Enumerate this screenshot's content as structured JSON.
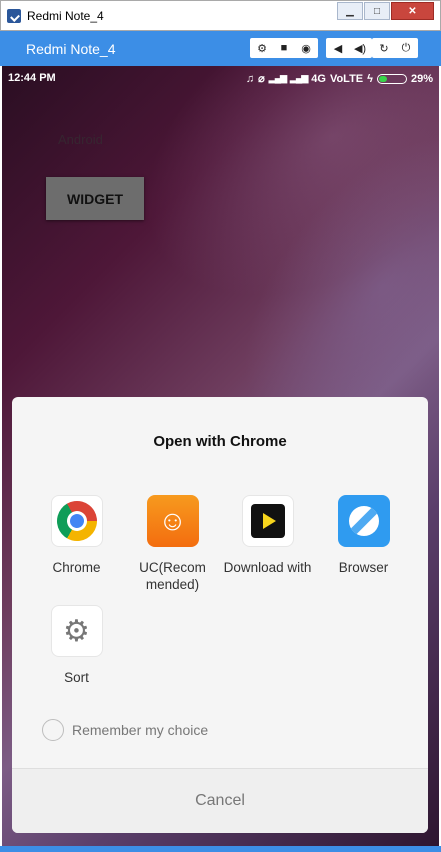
{
  "window": {
    "title": "Redmi Note_4",
    "controls": {
      "minimize": "▁",
      "maximize": "□",
      "close": "✕"
    }
  },
  "emulator": {
    "device_name": "Redmi Note_4",
    "tools": [
      {
        "name": "settings-icon",
        "glyph": "⚙"
      },
      {
        "name": "video-record-icon",
        "glyph": "■"
      },
      {
        "name": "camera-icon",
        "glyph": "◉"
      },
      {
        "name": "volume-down-icon",
        "glyph": "◀"
      },
      {
        "name": "volume-up-icon",
        "glyph": "◀)"
      },
      {
        "name": "rotate-icon",
        "glyph": "↻"
      },
      {
        "name": "power-icon",
        "glyph": "⏻"
      }
    ]
  },
  "status_bar": {
    "time": "12:44 PM",
    "network": "4G",
    "volte": "VoLTE",
    "battery": "29%",
    "battery_level": 0.29,
    "icons": [
      "headphones-icon",
      "alarm-off-icon",
      "signal-icon",
      "signal-icon",
      "charging-icon"
    ]
  },
  "app": {
    "label": "Android",
    "widget_button": "WIDGET"
  },
  "chooser": {
    "title": "Open with Chrome",
    "apps": [
      {
        "name": "Chrome"
      },
      {
        "name": "UC(Recom mended)"
      },
      {
        "name": "Download with"
      },
      {
        "name": "Browser"
      },
      {
        "name": "Sort"
      }
    ],
    "remember_label": "Remember my choice",
    "cancel_label": "Cancel"
  },
  "colors": {
    "emulator_bar": "#3c8ee6",
    "uc_orange": "#f57e14",
    "browser_blue": "#2f9bf0"
  }
}
